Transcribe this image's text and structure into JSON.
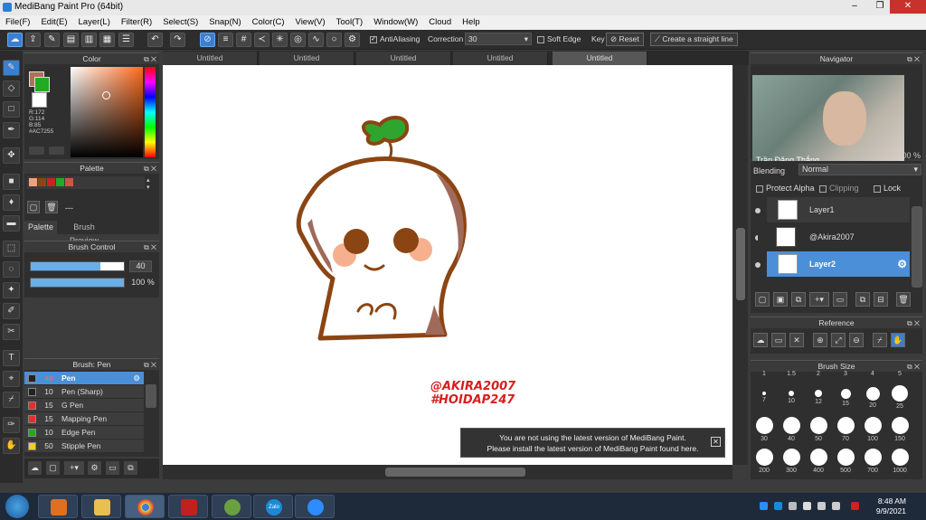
{
  "window": {
    "title": "MediBang Paint Pro (64bit)",
    "controls": [
      "–",
      "❐",
      "✕"
    ]
  },
  "menu": [
    "File(F)",
    "Edit(E)",
    "Layer(L)",
    "Filter(R)",
    "Select(S)",
    "Snap(N)",
    "Color(C)",
    "View(V)",
    "Tool(T)",
    "Window(W)",
    "Cloud",
    "Help"
  ],
  "toolbar": {
    "antialiasing": "AntiAliasing",
    "correction_label": "Correction",
    "correction_value": "30",
    "soft_edge": "Soft Edge",
    "key": "Key",
    "reset": "Reset",
    "straight_line": "Create a straight line"
  },
  "tabs": [
    "Untitled",
    "Untitled",
    "Untitled",
    "Untitled",
    "Untitled"
  ],
  "color_panel": {
    "title": "Color",
    "r": "R:172",
    "g": "G:114",
    "b": "B:85",
    "hex": "#AC7255",
    "main_color": "#AC7255"
  },
  "palette_panel": {
    "title": "Palette",
    "tab1": "Palette",
    "tab2": "Brush Preview",
    "item": "---",
    "swatches": [
      "#f0a080",
      "#8b4513",
      "#cc2222",
      "#22aa22",
      "#cc5544"
    ]
  },
  "brush_control": {
    "title": "Brush Control",
    "size": "40",
    "opacity": "100 %",
    "size_fill": 0.75,
    "opacity_fill": 1.0
  },
  "brush_panel": {
    "title": "Brush: Pen",
    "items": [
      {
        "size": "40",
        "name": "Pen",
        "color": "#222222",
        "selected": true
      },
      {
        "size": "10",
        "name": "Pen (Sharp)",
        "color": "#222222"
      },
      {
        "size": "15",
        "name": "G Pen",
        "color": "#e03030"
      },
      {
        "size": "15",
        "name": "Mapping Pen",
        "color": "#e03030"
      },
      {
        "size": "10",
        "name": "Edge Pen",
        "color": "#22aa22"
      },
      {
        "size": "50",
        "name": "Stipple Pen",
        "color": "#f0d020"
      }
    ]
  },
  "canvas": {
    "watermark1": "@AKIRA2007",
    "watermark2": "#HOIDAP247"
  },
  "notification": {
    "line1": "You are not using the latest version of MediBang Paint.",
    "line2": "Please install the latest version of MediBang Paint found here."
  },
  "navigator": {
    "title": "Navigator",
    "webcam_name": "Trần Đăng Thắng",
    "zoom": "00 %"
  },
  "layers": {
    "blending_label": "Blending",
    "blending_value": "Normal",
    "protect_alpha": "Protect Alpha",
    "clipping": "Clipping",
    "lock": "Lock",
    "items": [
      {
        "name": "Layer1"
      },
      {
        "name": "@Akira2007"
      },
      {
        "name": "Layer2",
        "selected": true
      }
    ]
  },
  "reference": {
    "title": "Reference"
  },
  "brush_size": {
    "title": "Brush Size",
    "top_row": [
      "1",
      "1.5",
      "2",
      "3",
      "4",
      "5"
    ],
    "rows": [
      [
        "7",
        "10",
        "12",
        "15",
        "20",
        "25"
      ],
      [
        "30",
        "40",
        "50",
        "70",
        "100",
        "150"
      ],
      [
        "200",
        "300",
        "400",
        "500",
        "700",
        "1000"
      ]
    ]
  },
  "taskbar": {
    "time": "8:48 AM",
    "date": "9/9/2021",
    "zalo": "Zalo"
  }
}
